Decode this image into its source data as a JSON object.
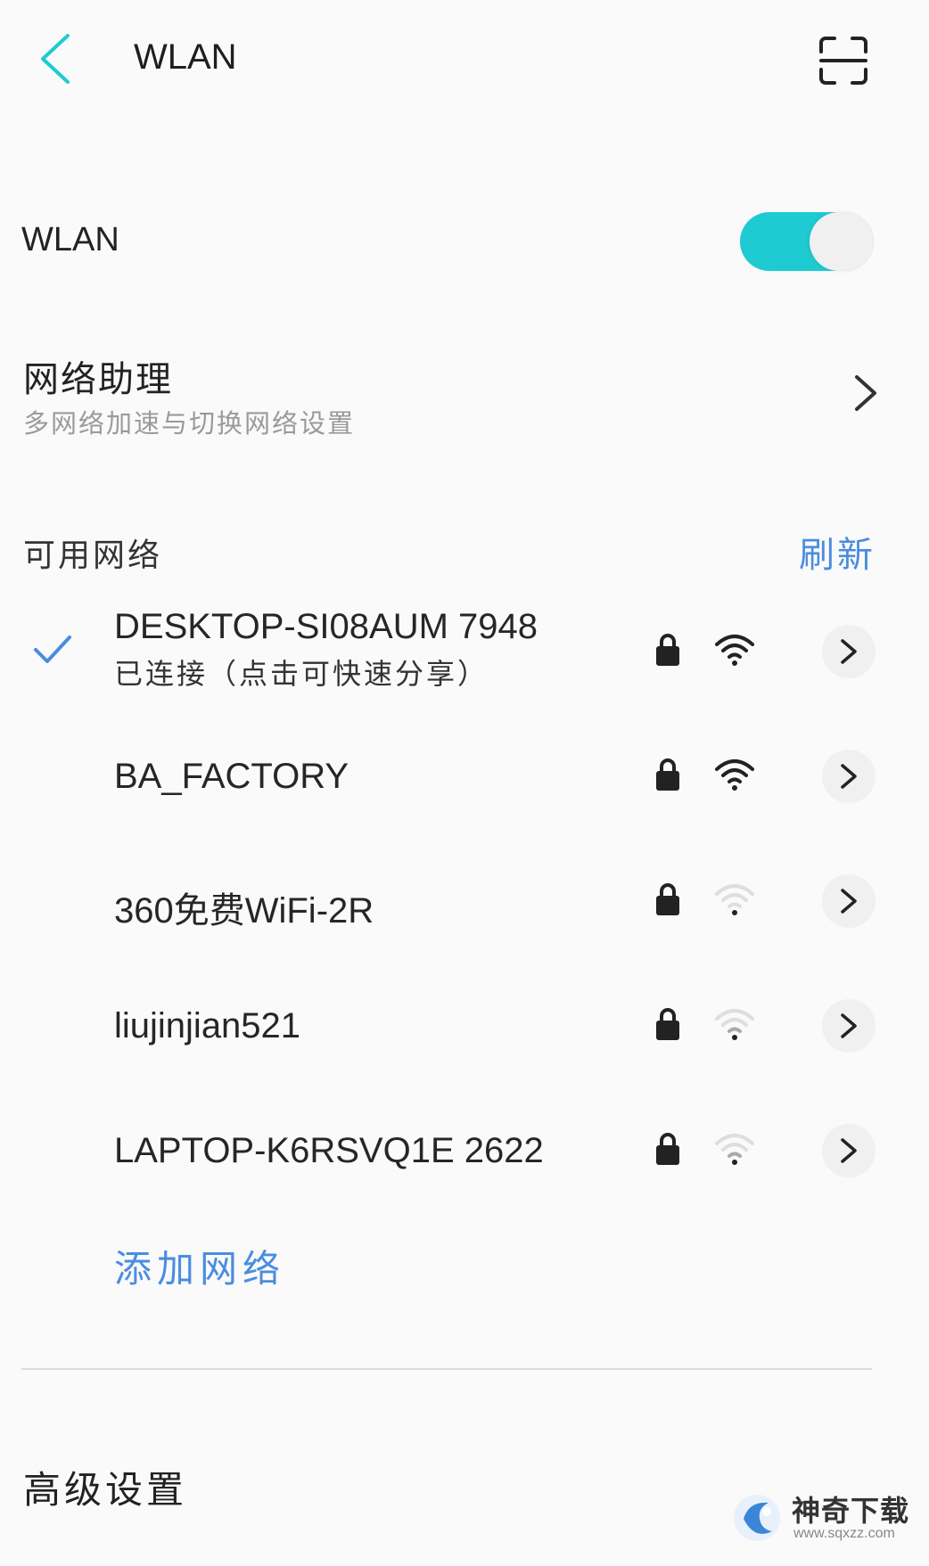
{
  "header": {
    "title": "WLAN",
    "back_icon": "chevron-left-icon",
    "scan_icon": "scan-icon",
    "accent": "#1ecbd2"
  },
  "wlan_toggle": {
    "label": "WLAN",
    "on": true,
    "color": "#1ecbd2"
  },
  "assistant": {
    "title": "网络助理",
    "subtitle": "多网络加速与切换网络设置"
  },
  "available": {
    "label": "可用网络",
    "refresh_label": "刷新",
    "link_color": "#4a8de0"
  },
  "networks": [
    {
      "ssid": "DESKTOP-SI08AUM 7948",
      "status": "已连接（点击可快速分享）",
      "connected": true,
      "locked": true,
      "signal": "strong"
    },
    {
      "ssid": "BA_FACTORY",
      "status": "",
      "connected": false,
      "locked": true,
      "signal": "strong"
    },
    {
      "ssid": "360免费WiFi-2R",
      "status": "",
      "connected": false,
      "locked": true,
      "signal": "weak"
    },
    {
      "ssid": "liujinjian521",
      "status": "",
      "connected": false,
      "locked": true,
      "signal": "weak"
    },
    {
      "ssid": "LAPTOP-K6RSVQ1E 2622",
      "status": "",
      "connected": false,
      "locked": true,
      "signal": "weak"
    }
  ],
  "add_network_label": "添加网络",
  "advanced_label": "高级设置",
  "watermark": {
    "name": "神奇下载",
    "url": "www.sqxzz.com"
  }
}
